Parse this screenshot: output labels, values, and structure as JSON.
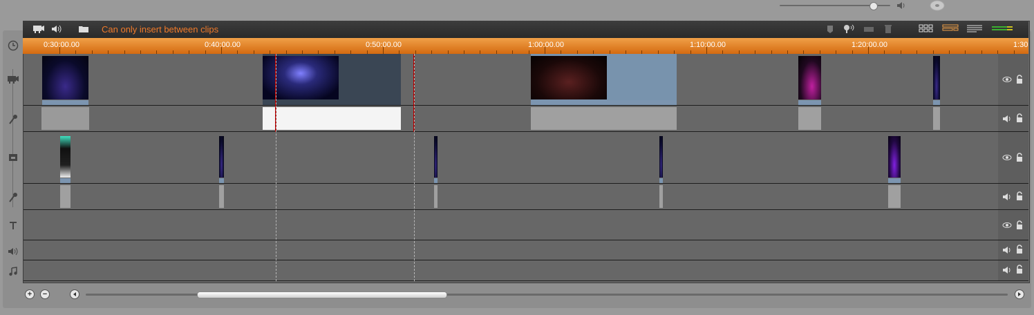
{
  "toolbar": {
    "status_message": "Can only insert between clips",
    "left_icons": [
      "video-camera-icon",
      "speaker-icon",
      "folder-icon"
    ],
    "right_icons": [
      "marker-icon",
      "voiceover-icon",
      "film-icon",
      "trash-icon",
      "storyboard-view-icon",
      "timeline-view-icon",
      "text-view-icon",
      "audio-meter-icon"
    ]
  },
  "master": {
    "volume_level": 0.85,
    "icons": [
      "speaker-icon",
      "disc-icon"
    ]
  },
  "ruler": {
    "labels": [
      "0:30:00.00",
      "0:40:00.00",
      "0:50:00.00",
      "1:00:00.00",
      "1:10:00.00",
      "1:20:00.00",
      "1:30"
    ]
  },
  "tracks": [
    {
      "name": "video-1",
      "type": "video",
      "icon": "video-camera-icon",
      "right_icons": [
        "eye-icon",
        "lock-icon"
      ]
    },
    {
      "name": "audio-1",
      "type": "audio",
      "icon": "microphone-icon",
      "right_icons": [
        "speaker-icon",
        "lock-icon"
      ]
    },
    {
      "name": "overlay-video",
      "type": "video",
      "icon": "overlay-icon",
      "right_icons": [
        "eye-icon",
        "lock-icon"
      ]
    },
    {
      "name": "overlay-audio",
      "type": "audio",
      "icon": "microphone-icon",
      "right_icons": [
        "speaker-icon",
        "lock-icon"
      ]
    },
    {
      "name": "title",
      "type": "title",
      "icon": "text-icon",
      "right_icons": [
        "eye-icon",
        "lock-icon"
      ]
    },
    {
      "name": "sound-effects",
      "type": "audio",
      "icon": "speaker-icon",
      "right_icons": [
        "speaker-icon",
        "lock-icon"
      ]
    },
    {
      "name": "music",
      "type": "audio",
      "icon": "music-note-icon",
      "right_icons": [
        "speaker-icon",
        "lock-icon"
      ]
    }
  ],
  "bottom": {
    "zoom_in": "+",
    "zoom_out": "−",
    "scroll_position": 0.12
  },
  "colors": {
    "accent": "#f07a2a",
    "ruler": "#e08020",
    "playhead": "#b00000",
    "clip_bar": "#7c95b0"
  }
}
